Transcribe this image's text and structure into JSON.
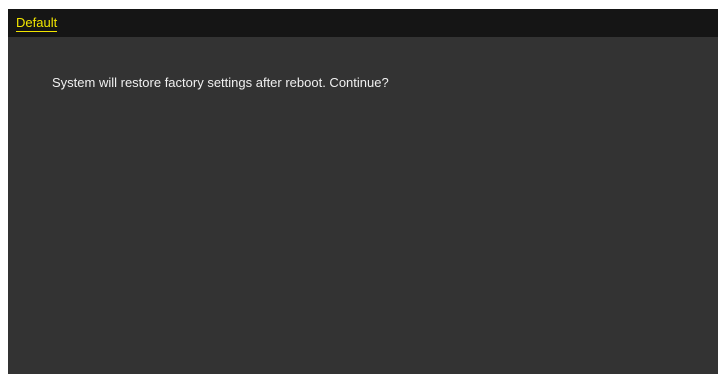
{
  "dialog": {
    "title": "Default",
    "message": "System will restore factory settings after reboot. Continue?"
  },
  "colors": {
    "accent": "#f2e500",
    "title_bar": "#151515",
    "panel": "#333333",
    "text": "#f0f0f0"
  }
}
